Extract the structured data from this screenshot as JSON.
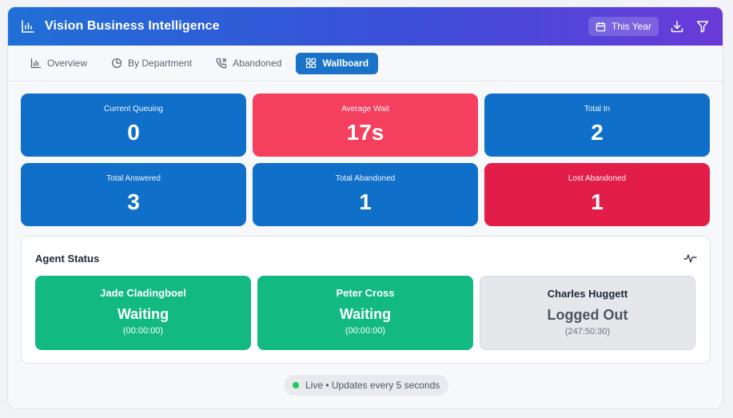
{
  "header": {
    "title": "Vision Business Intelligence",
    "brand_icon": "bar-chart-icon",
    "period_label": "This Year",
    "period_icon": "calendar-icon",
    "download_icon": "download-icon",
    "filter_icon": "filter-icon"
  },
  "tabs": [
    {
      "label": "Overview",
      "icon": "bar-chart-icon",
      "active": false
    },
    {
      "label": "By Department",
      "icon": "pie-chart-icon",
      "active": false
    },
    {
      "label": "Abandoned",
      "icon": "phone-missed-icon",
      "active": false
    },
    {
      "label": "Wallboard",
      "icon": "grid-icon",
      "active": true
    }
  ],
  "kpis": [
    {
      "label": "Current Queuing",
      "value": "0",
      "color": "#0f6fc9"
    },
    {
      "label": "Average Wait",
      "value": "17s",
      "color": "#f43f5e"
    },
    {
      "label": "Total In",
      "value": "2",
      "color": "#0f6fc9"
    },
    {
      "label": "Total Answered",
      "value": "3",
      "color": "#0f6fc9"
    },
    {
      "label": "Total Abandoned",
      "value": "1",
      "color": "#0f6fc9"
    },
    {
      "label": "Lost Abandoned",
      "value": "1",
      "color": "#e11d48"
    }
  ],
  "agent_status": {
    "title": "Agent Status",
    "icon": "activity-icon",
    "agents": [
      {
        "name": "Jade Cladingboel",
        "status": "Waiting",
        "time": "(00:00:00)",
        "color": "#12b981"
      },
      {
        "name": "Peter Cross",
        "status": "Waiting",
        "time": "(00:00:00)",
        "color": "#12b981"
      },
      {
        "name": "Charles Huggett",
        "status": "Logged Out",
        "time": "(247:50:30)",
        "color": "#e5e7eb"
      }
    ]
  },
  "live": {
    "text": "Live • Updates every 5 seconds",
    "dot_color": "#22c55e"
  }
}
